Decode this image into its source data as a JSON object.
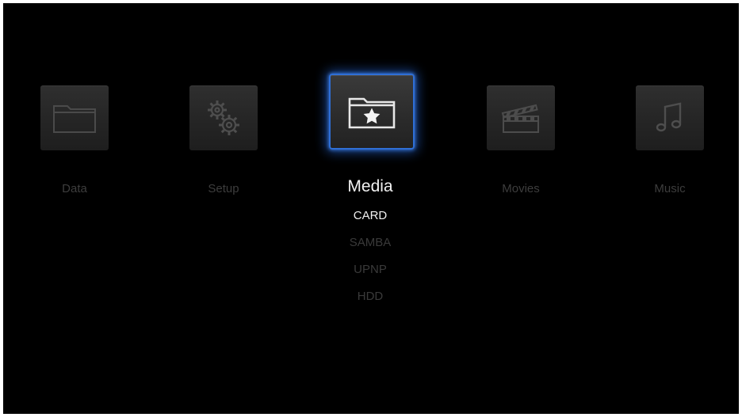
{
  "menu": {
    "items": [
      {
        "label": "Data",
        "icon": "folder-icon"
      },
      {
        "label": "Setup",
        "icon": "gears-icon"
      },
      {
        "label": "Media",
        "icon": "star-folder-icon",
        "selected": true,
        "submenu": [
          {
            "label": "CARD",
            "active": true
          },
          {
            "label": "SAMBA"
          },
          {
            "label": "UPNP"
          },
          {
            "label": "HDD"
          }
        ]
      },
      {
        "label": "Movies",
        "icon": "clapperboard-icon"
      },
      {
        "label": "Music",
        "icon": "music-note-icon"
      }
    ]
  },
  "colors": {
    "background": "#000000",
    "selection_glow": "#2f6fd6",
    "active_text": "#f0f0f0",
    "inactive_text": "#3d3d3d"
  }
}
